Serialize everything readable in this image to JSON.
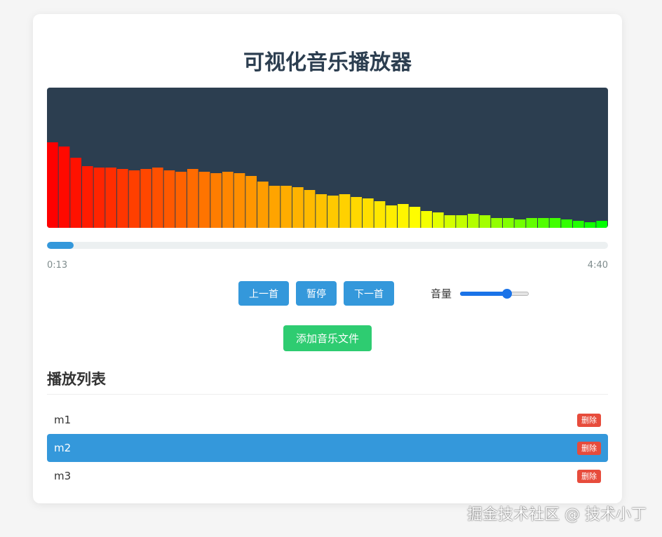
{
  "app": {
    "title": "可视化音乐播放器"
  },
  "visualizer": {
    "background": "#2c3e50",
    "bar_levels": [
      0.61,
      0.58,
      0.5,
      0.44,
      0.43,
      0.43,
      0.42,
      0.41,
      0.42,
      0.43,
      0.41,
      0.4,
      0.42,
      0.4,
      0.39,
      0.4,
      0.39,
      0.37,
      0.33,
      0.3,
      0.3,
      0.29,
      0.27,
      0.24,
      0.23,
      0.24,
      0.22,
      0.21,
      0.19,
      0.16,
      0.17,
      0.15,
      0.12,
      0.11,
      0.09,
      0.09,
      0.1,
      0.09,
      0.07,
      0.07,
      0.06,
      0.07,
      0.07,
      0.07,
      0.06,
      0.05,
      0.04,
      0.05
    ],
    "gradient_colors": [
      "#ff0000",
      "#ff8c00",
      "#ffff00",
      "#00ff00"
    ]
  },
  "progress": {
    "fraction": 0.047,
    "current_time": "0:13",
    "total_time": "4:40"
  },
  "controls": {
    "prev_label": "上一首",
    "pause_label": "暂停",
    "next_label": "下一首",
    "volume_label": "音量",
    "volume_fraction": 0.68
  },
  "add_file_label": "添加音乐文件",
  "playlist": {
    "title": "播放列表",
    "tracks": [
      {
        "name": "m1",
        "delete_label": "删除",
        "active": false
      },
      {
        "name": "m2",
        "delete_label": "删除",
        "active": true
      },
      {
        "name": "m3",
        "delete_label": "删除",
        "active": false
      }
    ]
  },
  "colors": {
    "primary": "#3498db",
    "success": "#2ecc71",
    "danger": "#e74c3c",
    "heading": "#2c3e50"
  },
  "watermark": "掘金技术社区 @ 技术小丁"
}
